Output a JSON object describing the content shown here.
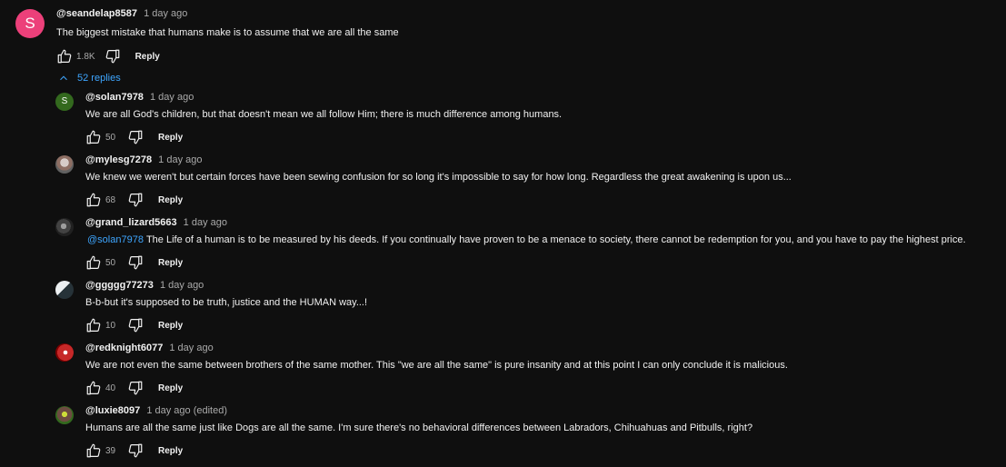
{
  "top_comment": {
    "avatar_letter": "S",
    "avatar_color": "#ec407a",
    "author": "@seandelap8587",
    "time": "1 day ago",
    "text": "The biggest mistake that humans make is to assume that we are all the same",
    "likes": "1.8K",
    "reply_label": "Reply"
  },
  "replies_toggle": {
    "label": "52 replies",
    "icon": "chevron-up-icon"
  },
  "replies": [
    {
      "author": "@solan7978",
      "time": "1 day ago",
      "text": "We are all God's children, but that doesn't mean we all follow Him; there is much difference among humans.",
      "likes": "50",
      "reply_label": "Reply",
      "avatar_letter": "S",
      "avatar_color": "#33691e"
    },
    {
      "author": "@mylesg7278",
      "time": "1 day ago",
      "text": "We knew we weren't but certain forces have been sewing confusion for so long it's impossible to say for how long. Regardless the great awakening is upon us...",
      "likes": "68",
      "reply_label": "Reply",
      "avatar_letter": "",
      "avatar_color": "#9e9e9e"
    },
    {
      "author": "@grand_lizard5663",
      "time": "1 day ago",
      "mention": "@solan7978",
      "text": "The Life of a human is to be measured by his deeds. If you continually have proven to be a menace to society, there cannot be redemption for you, and you have to pay the highest price.",
      "likes": "50",
      "reply_label": "Reply",
      "avatar_letter": "",
      "avatar_color": "#555555"
    },
    {
      "author": "@ggggg77273",
      "time": "1 day ago",
      "text": "B-b-but it's supposed to be truth, justice and the HUMAN way...!",
      "likes": "10",
      "reply_label": "Reply",
      "avatar_letter": "",
      "avatar_color": "#cfd8dc"
    },
    {
      "author": "@redknight6077",
      "time": "1 day ago",
      "text": "We are not even the same between brothers of the same mother. This \"we are all the same\" is pure insanity and at this point I can only conclude it is malicious.",
      "likes": "40",
      "reply_label": "Reply",
      "avatar_letter": "",
      "avatar_color": "#b71c1c"
    },
    {
      "author": "@luxie8097",
      "time": "1 day ago (edited)",
      "text": "Humans are all the same just like Dogs are all the same. I'm sure there's no behavioral differences between Labradors, Chihuahuas and Pitbulls, right?",
      "likes": "39",
      "reply_label": "Reply",
      "avatar_letter": "",
      "avatar_color": "#827717"
    }
  ],
  "icons": {
    "like": "thumbs-up-icon",
    "dislike": "thumbs-down-icon"
  }
}
